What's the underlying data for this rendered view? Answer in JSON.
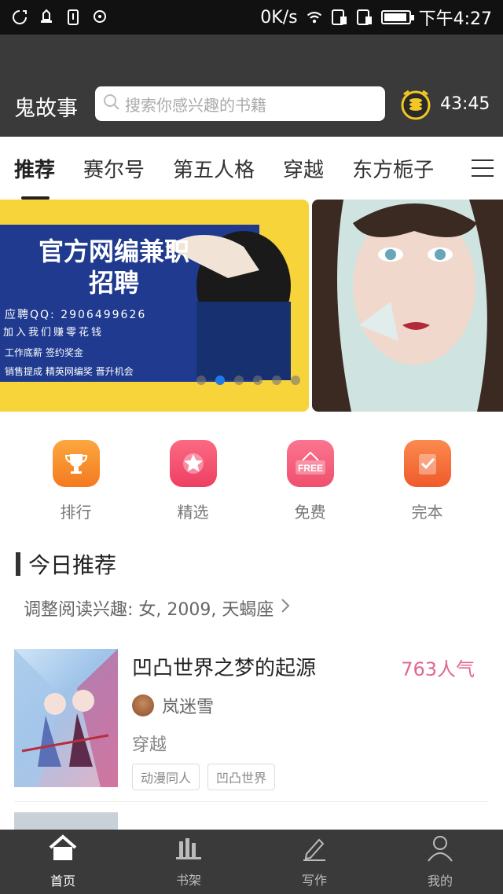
{
  "status_bar": {
    "network_speed": "0K/s",
    "time": "下午4:27"
  },
  "header": {
    "app_title": "鬼故事",
    "search_placeholder": "搜索你感兴趣的书籍",
    "coin_time": "43:45"
  },
  "tabs": [
    {
      "label": "推荐",
      "active": true
    },
    {
      "label": "赛尔号",
      "active": false
    },
    {
      "label": "第五人格",
      "active": false
    },
    {
      "label": "穿越",
      "active": false
    },
    {
      "label": "东方栀子",
      "active": false
    }
  ],
  "banner": {
    "headline_1": "官方网编兼职",
    "headline_2": "招聘",
    "qq": "应聘QQ: 2906499626",
    "strip": "加入我们赚零花钱",
    "row1": "工作底薪    签约奖金",
    "row2": "销售提成    精英网编奖    晋升机会",
    "dot_count": 6,
    "active_dot": 1
  },
  "quick_entries": [
    {
      "label": "排行",
      "icon": "trophy-icon",
      "color": "#f7962d"
    },
    {
      "label": "精选",
      "icon": "star-icon",
      "color": "#f0506e"
    },
    {
      "label": "免费",
      "icon": "free-icon",
      "color": "#f2607b"
    },
    {
      "label": "完本",
      "icon": "check-book-icon",
      "color": "#f46a34"
    }
  ],
  "section": {
    "title": "今日推荐",
    "interest": "调整阅读兴趣: 女, 2009, 天蝎座"
  },
  "book": {
    "title": "凹凸世界之梦的起源",
    "heat": "763人气",
    "author": "岚迷雪",
    "genre": "穿越",
    "tags": [
      "动漫同人",
      "凹凸世界"
    ]
  },
  "bottom_nav": [
    {
      "label": "首页",
      "icon": "home-icon",
      "active": true
    },
    {
      "label": "书架",
      "icon": "bookshelf-icon",
      "active": false
    },
    {
      "label": "写作",
      "icon": "pen-icon",
      "active": false
    },
    {
      "label": "我的",
      "icon": "profile-icon",
      "active": false
    }
  ],
  "colors": {
    "header_bg": "#3a3a3a",
    "accent_pink": "#e2678f",
    "banner_yellow": "#f6d43a",
    "banner_blue": "#1f3a8f"
  }
}
